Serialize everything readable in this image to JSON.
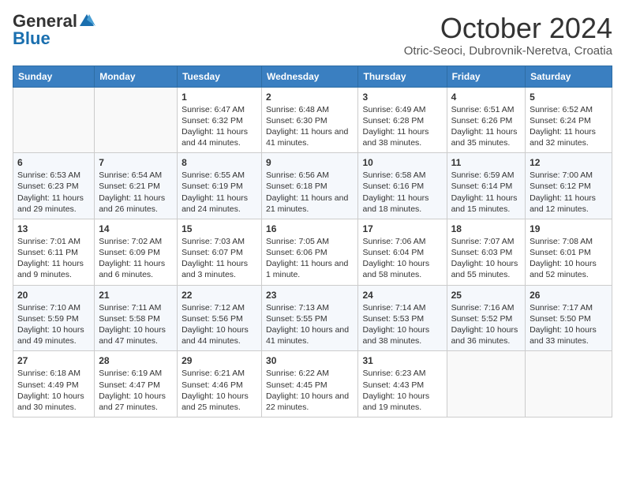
{
  "header": {
    "logo_general": "General",
    "logo_blue": "Blue",
    "month_title": "October 2024",
    "location": "Otric-Seoci, Dubrovnik-Neretva, Croatia"
  },
  "days_of_week": [
    "Sunday",
    "Monday",
    "Tuesday",
    "Wednesday",
    "Thursday",
    "Friday",
    "Saturday"
  ],
  "weeks": [
    [
      {
        "day": "",
        "info": ""
      },
      {
        "day": "",
        "info": ""
      },
      {
        "day": "1",
        "info": "Sunrise: 6:47 AM\nSunset: 6:32 PM\nDaylight: 11 hours and 44 minutes."
      },
      {
        "day": "2",
        "info": "Sunrise: 6:48 AM\nSunset: 6:30 PM\nDaylight: 11 hours and 41 minutes."
      },
      {
        "day": "3",
        "info": "Sunrise: 6:49 AM\nSunset: 6:28 PM\nDaylight: 11 hours and 38 minutes."
      },
      {
        "day": "4",
        "info": "Sunrise: 6:51 AM\nSunset: 6:26 PM\nDaylight: 11 hours and 35 minutes."
      },
      {
        "day": "5",
        "info": "Sunrise: 6:52 AM\nSunset: 6:24 PM\nDaylight: 11 hours and 32 minutes."
      }
    ],
    [
      {
        "day": "6",
        "info": "Sunrise: 6:53 AM\nSunset: 6:23 PM\nDaylight: 11 hours and 29 minutes."
      },
      {
        "day": "7",
        "info": "Sunrise: 6:54 AM\nSunset: 6:21 PM\nDaylight: 11 hours and 26 minutes."
      },
      {
        "day": "8",
        "info": "Sunrise: 6:55 AM\nSunset: 6:19 PM\nDaylight: 11 hours and 24 minutes."
      },
      {
        "day": "9",
        "info": "Sunrise: 6:56 AM\nSunset: 6:18 PM\nDaylight: 11 hours and 21 minutes."
      },
      {
        "day": "10",
        "info": "Sunrise: 6:58 AM\nSunset: 6:16 PM\nDaylight: 11 hours and 18 minutes."
      },
      {
        "day": "11",
        "info": "Sunrise: 6:59 AM\nSunset: 6:14 PM\nDaylight: 11 hours and 15 minutes."
      },
      {
        "day": "12",
        "info": "Sunrise: 7:00 AM\nSunset: 6:12 PM\nDaylight: 11 hours and 12 minutes."
      }
    ],
    [
      {
        "day": "13",
        "info": "Sunrise: 7:01 AM\nSunset: 6:11 PM\nDaylight: 11 hours and 9 minutes."
      },
      {
        "day": "14",
        "info": "Sunrise: 7:02 AM\nSunset: 6:09 PM\nDaylight: 11 hours and 6 minutes."
      },
      {
        "day": "15",
        "info": "Sunrise: 7:03 AM\nSunset: 6:07 PM\nDaylight: 11 hours and 3 minutes."
      },
      {
        "day": "16",
        "info": "Sunrise: 7:05 AM\nSunset: 6:06 PM\nDaylight: 11 hours and 1 minute."
      },
      {
        "day": "17",
        "info": "Sunrise: 7:06 AM\nSunset: 6:04 PM\nDaylight: 10 hours and 58 minutes."
      },
      {
        "day": "18",
        "info": "Sunrise: 7:07 AM\nSunset: 6:03 PM\nDaylight: 10 hours and 55 minutes."
      },
      {
        "day": "19",
        "info": "Sunrise: 7:08 AM\nSunset: 6:01 PM\nDaylight: 10 hours and 52 minutes."
      }
    ],
    [
      {
        "day": "20",
        "info": "Sunrise: 7:10 AM\nSunset: 5:59 PM\nDaylight: 10 hours and 49 minutes."
      },
      {
        "day": "21",
        "info": "Sunrise: 7:11 AM\nSunset: 5:58 PM\nDaylight: 10 hours and 47 minutes."
      },
      {
        "day": "22",
        "info": "Sunrise: 7:12 AM\nSunset: 5:56 PM\nDaylight: 10 hours and 44 minutes."
      },
      {
        "day": "23",
        "info": "Sunrise: 7:13 AM\nSunset: 5:55 PM\nDaylight: 10 hours and 41 minutes."
      },
      {
        "day": "24",
        "info": "Sunrise: 7:14 AM\nSunset: 5:53 PM\nDaylight: 10 hours and 38 minutes."
      },
      {
        "day": "25",
        "info": "Sunrise: 7:16 AM\nSunset: 5:52 PM\nDaylight: 10 hours and 36 minutes."
      },
      {
        "day": "26",
        "info": "Sunrise: 7:17 AM\nSunset: 5:50 PM\nDaylight: 10 hours and 33 minutes."
      }
    ],
    [
      {
        "day": "27",
        "info": "Sunrise: 6:18 AM\nSunset: 4:49 PM\nDaylight: 10 hours and 30 minutes."
      },
      {
        "day": "28",
        "info": "Sunrise: 6:19 AM\nSunset: 4:47 PM\nDaylight: 10 hours and 27 minutes."
      },
      {
        "day": "29",
        "info": "Sunrise: 6:21 AM\nSunset: 4:46 PM\nDaylight: 10 hours and 25 minutes."
      },
      {
        "day": "30",
        "info": "Sunrise: 6:22 AM\nSunset: 4:45 PM\nDaylight: 10 hours and 22 minutes."
      },
      {
        "day": "31",
        "info": "Sunrise: 6:23 AM\nSunset: 4:43 PM\nDaylight: 10 hours and 19 minutes."
      },
      {
        "day": "",
        "info": ""
      },
      {
        "day": "",
        "info": ""
      }
    ]
  ]
}
